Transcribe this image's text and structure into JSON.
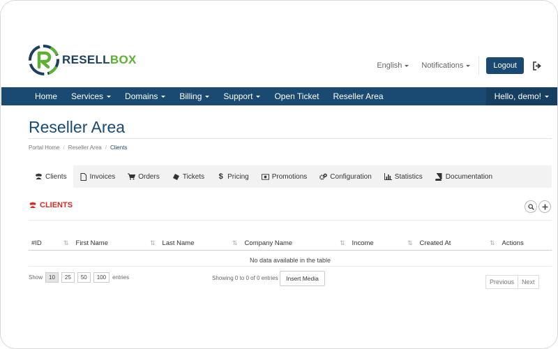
{
  "brand": {
    "name_part1": "RESELL",
    "name_part2": "BOX",
    "color_primary": "#1d3f5f",
    "color_accent": "#5cb034"
  },
  "topbar": {
    "language": "English",
    "notifications": "Notifications",
    "logout": "Logout",
    "signout_icon": "sign-out-icon"
  },
  "nav": {
    "items": [
      {
        "label": "Home",
        "dropdown": false
      },
      {
        "label": "Services",
        "dropdown": true
      },
      {
        "label": "Domains",
        "dropdown": true
      },
      {
        "label": "Billing",
        "dropdown": true
      },
      {
        "label": "Support",
        "dropdown": true
      },
      {
        "label": "Open Ticket",
        "dropdown": false
      },
      {
        "label": "Reseller Area",
        "dropdown": false
      }
    ],
    "user": "Hello, demo!",
    "bg_color": "#1a4a72"
  },
  "page": {
    "title": "Reseller Area",
    "breadcrumb": [
      "Portal Home",
      "Reseller Area",
      "Clients"
    ]
  },
  "tabs": [
    {
      "label": "Clients",
      "icon": "users-icon",
      "active": true
    },
    {
      "label": "Invoices",
      "icon": "file-icon",
      "active": false
    },
    {
      "label": "Orders",
      "icon": "cart-icon",
      "active": false
    },
    {
      "label": "Tickets",
      "icon": "ticket-icon",
      "active": false
    },
    {
      "label": "Pricing",
      "icon": "dollar-icon",
      "active": false
    },
    {
      "label": "Promotions",
      "icon": "promotion-icon",
      "active": false
    },
    {
      "label": "Configuration",
      "icon": "gears-icon",
      "active": false
    },
    {
      "label": "Statistics",
      "icon": "bar-chart-icon",
      "active": false
    },
    {
      "label": "Documentation",
      "icon": "book-icon",
      "active": false
    }
  ],
  "section": {
    "title": "CLIENTS",
    "icon": "users-icon",
    "color": "#d9281e"
  },
  "table": {
    "columns": [
      "#ID",
      "First Name",
      "Last Name",
      "Company Name",
      "Income",
      "Created At",
      "Actions"
    ],
    "empty_message": "No data available in the table"
  },
  "footer": {
    "show_label": "Show",
    "page_sizes": [
      "10",
      "25",
      "50",
      "100"
    ],
    "selected_size": "10",
    "entries_label": "entries",
    "showing_text": "Showing 0 to 0 of 0 entries",
    "insert_media": "Insert Media",
    "previous": "Previous",
    "next": "Next"
  }
}
